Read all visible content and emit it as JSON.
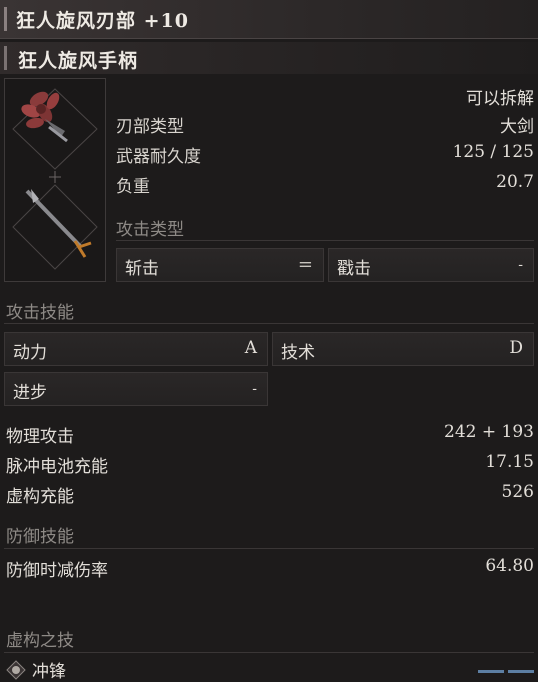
{
  "title": "狂人旋风刃部 +10",
  "handle_name": "狂人旋风手柄",
  "detachable": "可以拆解",
  "stats": [
    {
      "label": "刃部类型",
      "value": "大剑"
    },
    {
      "label": "武器耐久度",
      "value": "125 / 125"
    },
    {
      "label": "负重",
      "value": "20.7"
    }
  ],
  "attack_type": {
    "header": "攻击类型",
    "left": "斩击",
    "equals": "=",
    "right": "戳击",
    "right_value": "-"
  },
  "attack_skill": {
    "header": "攻击技能",
    "items": [
      {
        "label": "动力",
        "grade": "A"
      },
      {
        "label": "技术",
        "grade": "D"
      },
      {
        "label": "进步",
        "grade": "-"
      }
    ]
  },
  "attack": [
    {
      "label": "物理攻击",
      "value": "242 + 193"
    },
    {
      "label": "脉冲电池充能",
      "value": "17.15"
    },
    {
      "label": "虚构充能",
      "value": "526"
    }
  ],
  "defense": {
    "header": "防御技能",
    "label": "防御时减伤率",
    "value": "64.80"
  },
  "fable": {
    "header": "虚构之技",
    "skill_name": "冲锋",
    "skill_icon": "fist-emblem-icon",
    "charge_segments": 2
  },
  "colors": {
    "accent_blue": "#5d7fa3"
  }
}
